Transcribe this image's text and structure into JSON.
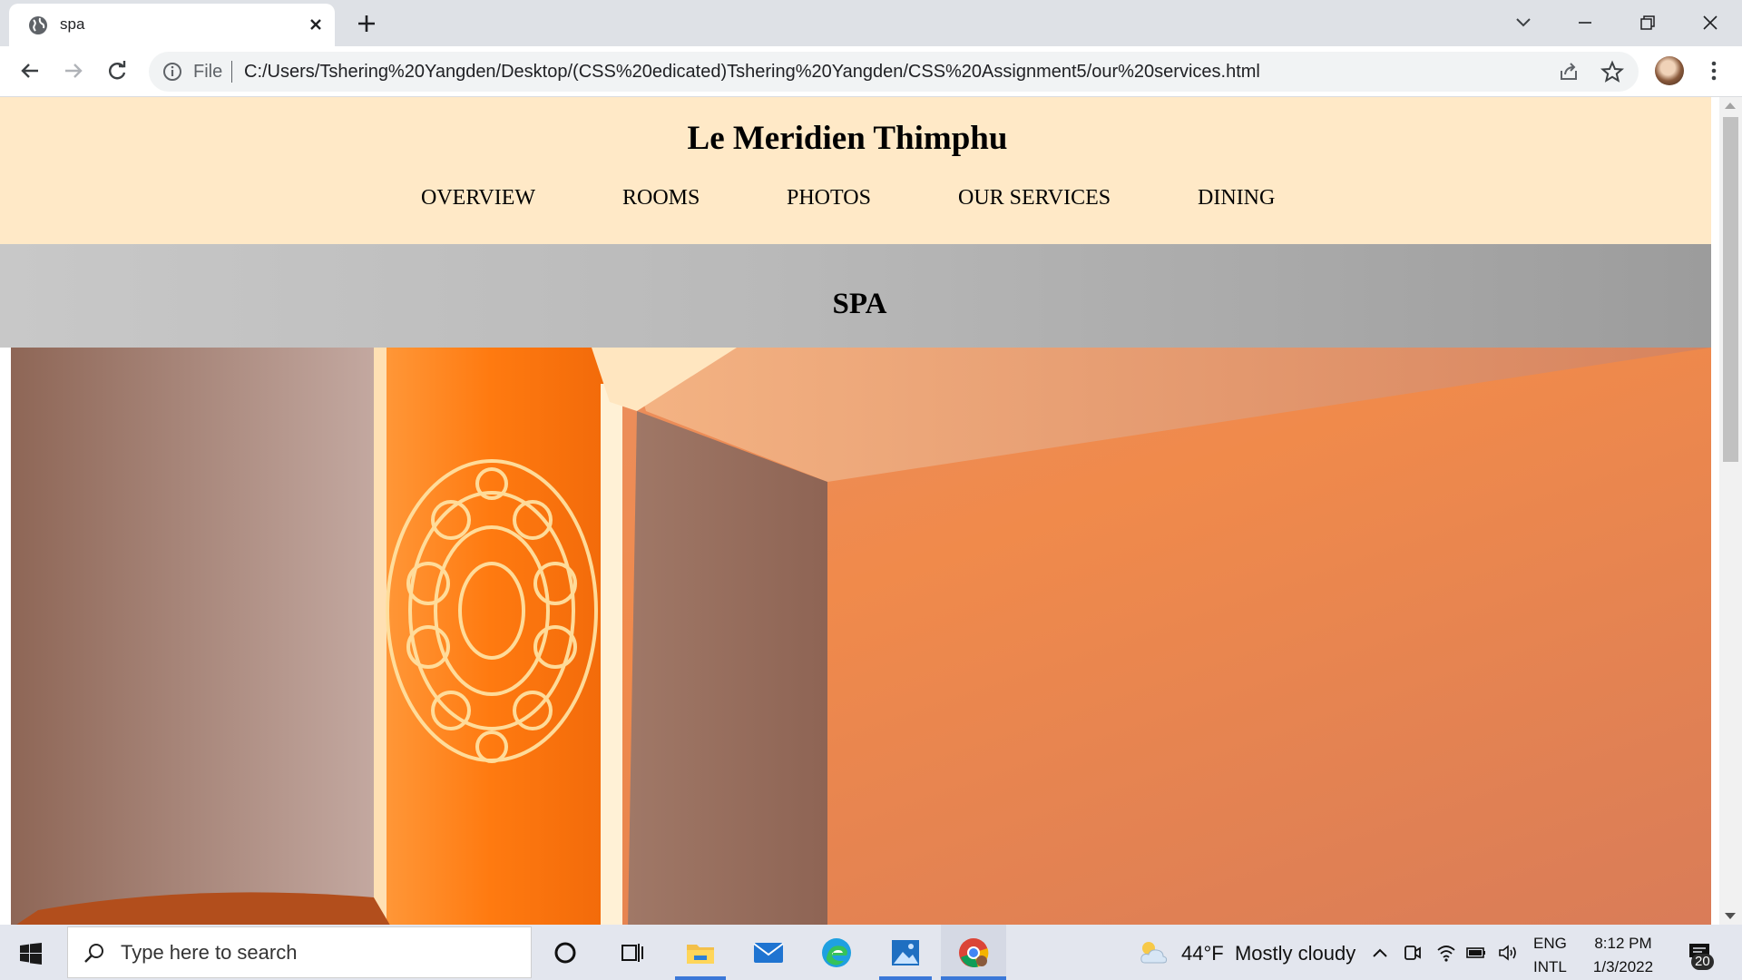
{
  "browser": {
    "tab_title": "spa",
    "address": {
      "scheme_label": "File",
      "url": "C:/Users/Tshering%20Yangden/Desktop/(CSS%20edicated)Tshering%20Yangden/CSS%20Assignment5/our%20services.html"
    }
  },
  "page": {
    "site_title": "Le Meridien Thimphu",
    "nav": [
      {
        "label": "OVERVIEW"
      },
      {
        "label": "ROOMS"
      },
      {
        "label": "PHOTOS"
      },
      {
        "label": "OUR SERVICES"
      },
      {
        "label": "DINING"
      }
    ],
    "section_title": "SPA",
    "colors": {
      "header_bg": "#ffe9c7",
      "band_bg": "#b9b9b9",
      "photo_accent": "#f08a4b"
    }
  },
  "taskbar": {
    "search_placeholder": "Type here to search",
    "weather": {
      "temp": "44°F",
      "condition": "Mostly cloudy"
    },
    "language": {
      "line1": "ENG",
      "line2": "INTL"
    },
    "clock": {
      "time": "8:12 PM",
      "date": "1/3/2022"
    },
    "notification_count": "20",
    "pinned_apps": [
      "cortana-icon",
      "task-view-icon",
      "file-explorer-icon",
      "mail-icon",
      "edge-icon",
      "photos-icon",
      "chrome-icon"
    ]
  }
}
